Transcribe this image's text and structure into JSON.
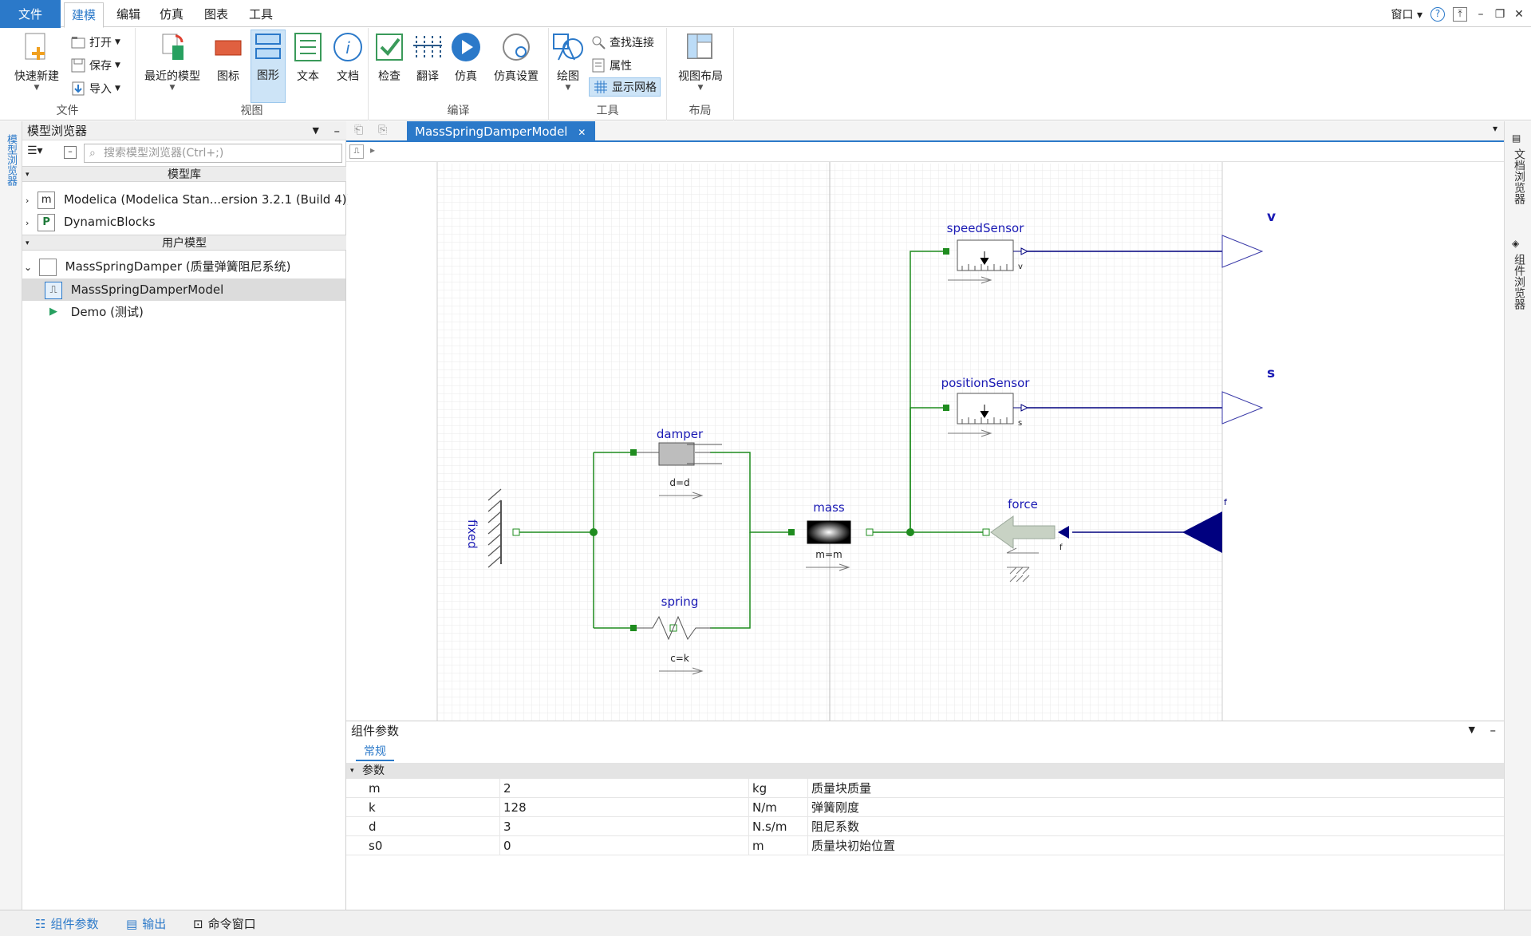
{
  "menu_tabs": {
    "file": "文件",
    "model": "建模",
    "edit": "编辑",
    "simulate": "仿真",
    "chart": "图表",
    "tools": "工具"
  },
  "window_controls": {
    "window": "窗口"
  },
  "ribbon": {
    "file_group": {
      "label": "文件",
      "quick_new": "快速新建",
      "open": "打开",
      "save": "保存",
      "import": "导入"
    },
    "view_group": {
      "label": "视图",
      "recent": "最近的模型",
      "icon_view": "图标",
      "diagram_view": "图形",
      "text_view": "文本",
      "doc_view": "文档"
    },
    "compile_group": {
      "label": "编译",
      "check": "检查",
      "translate": "翻译",
      "simulate": "仿真",
      "sim_settings": "仿真设置"
    },
    "tools_group": {
      "label": "工具",
      "draw": "绘图",
      "find_conn": "查找连接",
      "properties": "属性",
      "show_grid": "显示网格"
    },
    "layout_group": {
      "label": "布局",
      "view_layout": "视图布局"
    }
  },
  "browser": {
    "title": "模型浏览器",
    "search_placeholder": "搜索模型浏览器(Ctrl+;)",
    "section_libs": "模型库",
    "section_user": "用户模型",
    "libs": [
      {
        "label": "Modelica (Modelica Stan...ersion 3.2.1 (Build 4))",
        "icon": "modelica-icon"
      },
      {
        "label": "DynamicBlocks",
        "icon": "package-icon"
      }
    ],
    "user": {
      "root": "MassSpringDamper (质量弹簧阻尼系统)",
      "children": [
        "MassSpringDamperModel",
        "Demo (测试)"
      ]
    }
  },
  "left_strip_label": "模型浏览器",
  "doc_tab": "MassSpringDamperModel",
  "diagram": {
    "fixed": "fixed",
    "damper": "damper",
    "damper_param": "d=d",
    "spring": "spring",
    "spring_param": "c=k",
    "mass": "mass",
    "mass_param": "m=m",
    "force": "force",
    "force_port": "f",
    "force_in": "f",
    "speedSensor": "speedSensor",
    "speed_port": "v",
    "positionSensor": "positionSensor",
    "pos_port": "s",
    "out_v": "v",
    "out_s": "s"
  },
  "params": {
    "title": "组件参数",
    "tab": "常规",
    "section": "参数",
    "rows": [
      {
        "name": "m",
        "value": "2",
        "unit": "kg",
        "desc": "质量块质量"
      },
      {
        "name": "k",
        "value": "128",
        "unit": "N/m",
        "desc": "弹簧刚度"
      },
      {
        "name": "d",
        "value": "3",
        "unit": "N.s/m",
        "desc": "阻尼系数"
      },
      {
        "name": "s0",
        "value": "0",
        "unit": "m",
        "desc": "质量块初始位置"
      }
    ]
  },
  "right_strip": {
    "doc_browser": "文档浏览器",
    "comp_browser": "组件浏览器"
  },
  "bottom_tabs": {
    "params": "组件参数",
    "output": "输出",
    "cmd": "命令窗口"
  },
  "colors": {
    "accent": "#2b79c9",
    "wire_green": "#1f8c1f",
    "wire_blue": "#00007f",
    "label_blue": "#1a1ab4"
  }
}
